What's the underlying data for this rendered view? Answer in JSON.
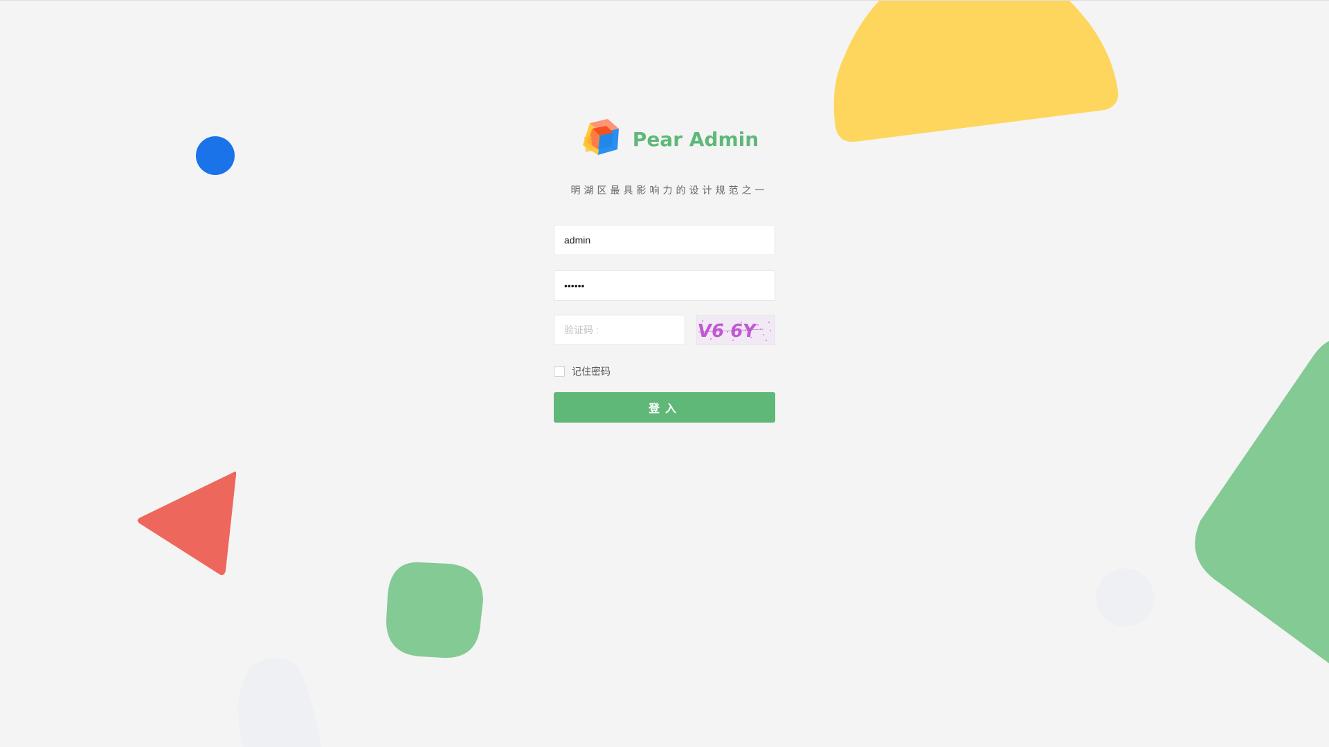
{
  "app": {
    "title": "Pear Admin",
    "tagline": "明湖区最具影响力的设计规范之一"
  },
  "form": {
    "username": {
      "value": "admin",
      "placeholder": ""
    },
    "password": {
      "value": "123456",
      "placeholder": ""
    },
    "captcha": {
      "value": "",
      "placeholder": "验证码 :",
      "image_text": "V6 6Y"
    },
    "remember_label": "记住密码",
    "remember_checked": false,
    "submit_label": "登入"
  },
  "colors": {
    "brand": "#5fb878",
    "background": "#f4f4f4",
    "shape_blue": "#1a73e8",
    "shape_red": "#ee675c",
    "shape_green": "#84ca95",
    "shape_yellow": "#fed65d",
    "shape_faint": "#eef0f4",
    "captcha_ink": "#c157d3"
  },
  "icons": {
    "logo": "pear-cube-logo"
  }
}
